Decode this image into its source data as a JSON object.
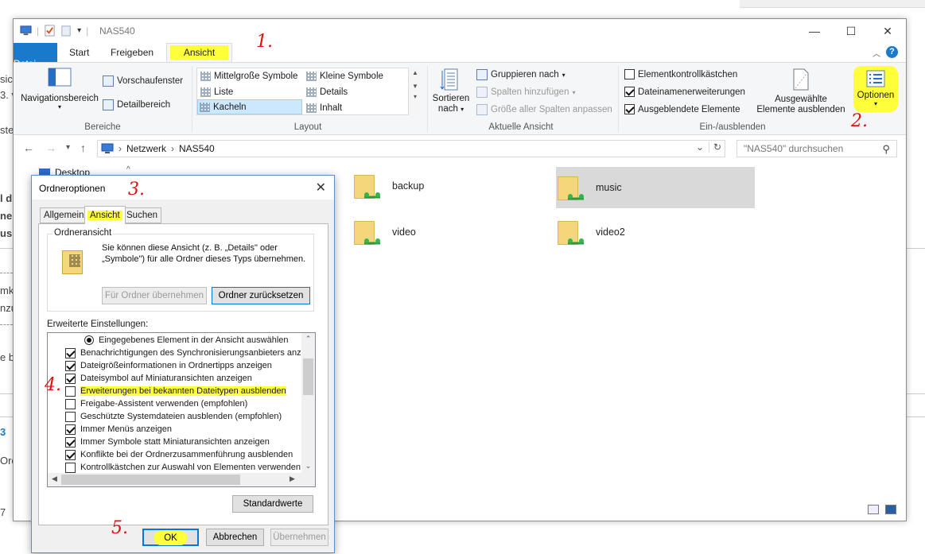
{
  "background": {
    "fragments": [
      "sic",
      "3. v",
      "ste",
      "l d",
      "ne",
      "us",
      "mk",
      "nzu",
      "e b",
      "3",
      "Ord",
      "7"
    ]
  },
  "window": {
    "title": "NAS540",
    "controls": {
      "minimize": "—",
      "maximize": "☐",
      "close": "✕"
    },
    "help": "?"
  },
  "ribbon_tabs": [
    "Datei",
    "Start",
    "Freigeben",
    "Ansicht"
  ],
  "ribbon": {
    "bereiche": {
      "label": "Bereiche",
      "navigationsbereich": "Navigationsbereich",
      "vorschaufenster": "Vorschaufenster",
      "detailbereich": "Detailbereich"
    },
    "layout": {
      "label": "Layout",
      "items": [
        "Mittelgroße Symbole",
        "Kleine Symbole",
        "Liste",
        "Details",
        "Kacheln",
        "Inhalt"
      ]
    },
    "aktuelle_ansicht": {
      "label": "Aktuelle Ansicht",
      "sortieren": "Sortieren",
      "nach": "nach",
      "gruppieren": "Gruppieren nach",
      "spalten": "Spalten hinzufügen",
      "groesse": "Größe aller Spalten anpassen"
    },
    "einausblenden": {
      "label": "Ein-/ausblenden",
      "elementkontroll": "Elementkontrollkästchen",
      "dateinamen": "Dateinamenerweiterungen",
      "ausgeblendete": "Ausgeblendete Elemente",
      "auswahl1": "Ausgewählte",
      "auswahl2": "Elemente ausblenden",
      "optionen": "Optionen"
    }
  },
  "address": {
    "path": [
      "Netzwerk",
      "NAS540"
    ],
    "search_placeholder": "\"NAS540\" durchsuchen"
  },
  "nav_pane": {
    "desktop": "Desktop"
  },
  "files": [
    "backup",
    "music",
    "video",
    "video2"
  ],
  "annotations": [
    "1.",
    "2.",
    "3.",
    "4.",
    "5."
  ],
  "dialog": {
    "title": "Ordneroptionen",
    "tabs": [
      "Allgemein",
      "Ansicht",
      "Suchen"
    ],
    "ordneransicht": {
      "legend": "Ordneransicht",
      "text": "Sie können diese Ansicht (z. B. „Details\" oder „Symbole\") für alle Ordner dieses Typs übernehmen.",
      "btn_apply": "Für Ordner übernehmen",
      "btn_reset": "Ordner zurücksetzen"
    },
    "advanced_label": "Erweiterte Einstellungen:",
    "advanced": [
      "Eingegebenes Element in der Ansicht auswählen",
      "Benachrichtigungen des Synchronisierungsanbieters anzeig",
      "Dateigrößeinformationen in Ordnertipps anzeigen",
      "Dateisymbol auf Miniaturansichten anzeigen",
      "Erweiterungen bei bekannten Dateitypen ausblenden",
      "Freigabe-Assistent verwenden (empfohlen)",
      "Geschützte Systemdateien ausblenden (empfohlen)",
      "Immer Menüs anzeigen",
      "Immer Symbole statt Miniaturansichten anzeigen",
      "Konflikte bei der Ordnerzusammenführung ausblenden",
      "Kontrollkästchen zur Auswahl von Elementen verwenden"
    ],
    "standardwerte": "Standardwerte",
    "ok": "OK",
    "abbrechen": "Abbrechen",
    "uebernehmen": "Übernehmen"
  },
  "colors": {
    "accent": "#1979ca",
    "highlight": "#ffff3a",
    "annotation": "#e01010"
  }
}
